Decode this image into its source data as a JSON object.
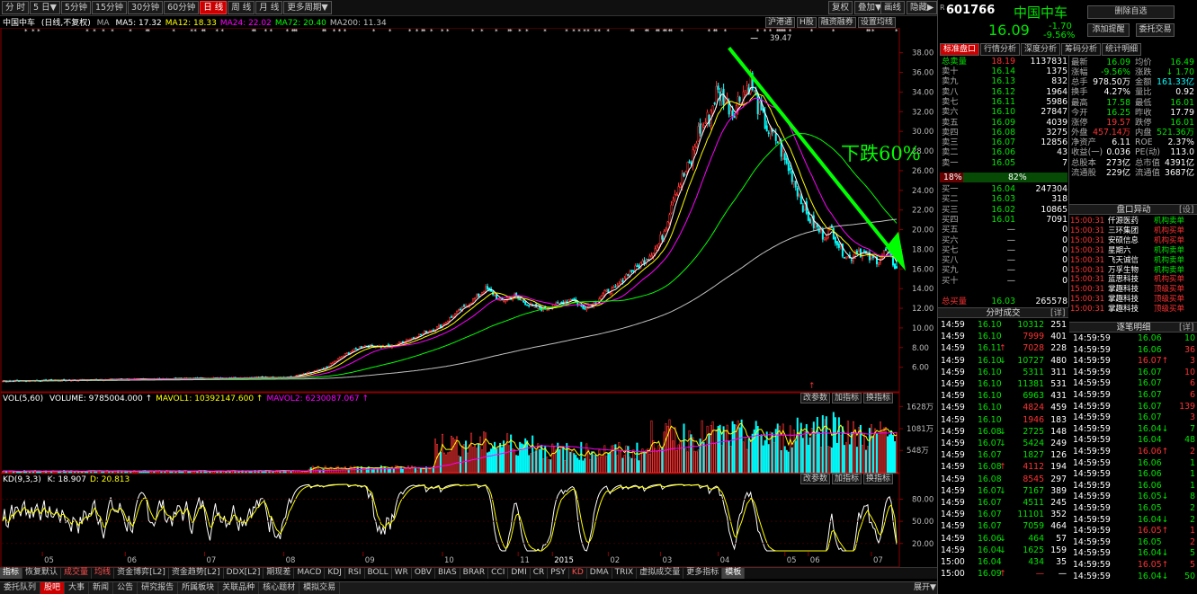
{
  "toolbar": {
    "periods": [
      "分 时",
      "5 日▼",
      "5分钟",
      "15分钟",
      "30分钟",
      "60分钟",
      "日 线",
      "周 线",
      "月 线",
      "更多周期▼"
    ],
    "active_period": "日 线",
    "right_buttons": [
      "复权",
      "叠加▼",
      "画线",
      "隐藏▶"
    ]
  },
  "main_info": {
    "stock": "中国中车",
    "mode": "(日线,不复权)",
    "ma_label": "MA",
    "ma": [
      {
        "label": "MA5: 17.32",
        "color": "#ffffff"
      },
      {
        "label": "MA12: 18.33",
        "color": "#ffff00"
      },
      {
        "label": "MA24: 22.02",
        "color": "#ff00ff"
      },
      {
        "label": "MA72: 20.40",
        "color": "#00ff00"
      },
      {
        "label": "MA200: 11.34",
        "color": "#c0c0c0"
      }
    ],
    "buttons": [
      "沪港通",
      "H股",
      "融资融券",
      "设置均线"
    ]
  },
  "vol_info": {
    "label": "VOL(5,60)",
    "items": [
      {
        "label": "VOLUME: 9785004.000",
        "color": "#ffffff"
      },
      {
        "label": "MAVOL1: 10392147.600",
        "color": "#ffff00"
      },
      {
        "label": "MAVOL2: 6230087.067",
        "color": "#ff00ff"
      }
    ],
    "buttons": [
      "改参数",
      "加指标",
      "换指标"
    ]
  },
  "kd_info": {
    "label": "KD(9,3,3)",
    "items": [
      {
        "label": "K: 18.907",
        "color": "#ffffff"
      },
      {
        "label": "D: 20.813",
        "color": "#ffff00"
      }
    ],
    "buttons": [
      "改参数",
      "加指标",
      "换指标"
    ]
  },
  "annotation": {
    "text": "下跌60%",
    "color": "#00ff00",
    "max_label": "39.47",
    "min_marker": "↑"
  },
  "bottom_tabs": [
    {
      "label": "指标",
      "style": "sel"
    },
    {
      "label": "恢复默认",
      "style": ""
    },
    {
      "label": "成交量",
      "style": "red"
    },
    {
      "label": "均线",
      "style": "red"
    },
    {
      "label": "资金博弈[L2]",
      "style": ""
    },
    {
      "label": "资金趋势[L2]",
      "style": ""
    },
    {
      "label": "DDX[L2]",
      "style": ""
    },
    {
      "label": "期现差",
      "style": ""
    },
    {
      "label": "MACD",
      "style": ""
    },
    {
      "label": "KDJ",
      "style": ""
    },
    {
      "label": "RSI",
      "style": ""
    },
    {
      "label": "BOLL",
      "style": ""
    },
    {
      "label": "WR",
      "style": ""
    },
    {
      "label": "OBV",
      "style": ""
    },
    {
      "label": "BIAS",
      "style": ""
    },
    {
      "label": "BRAR",
      "style": ""
    },
    {
      "label": "CCI",
      "style": ""
    },
    {
      "label": "DMI",
      "style": ""
    },
    {
      "label": "CR",
      "style": ""
    },
    {
      "label": "PSY",
      "style": ""
    },
    {
      "label": "KD",
      "style": "red"
    },
    {
      "label": "DMA",
      "style": ""
    },
    {
      "label": "TRIX",
      "style": ""
    },
    {
      "label": "虚拟成交量",
      "style": ""
    },
    {
      "label": "更多指标",
      "style": ""
    },
    {
      "label": "模板",
      "style": "sel"
    }
  ],
  "taskbar": {
    "items": [
      "委托队列",
      "股吧",
      "大事",
      "新闻",
      "公告",
      "研究报告",
      "所属板块",
      "关联品种",
      "核心题材",
      "模拟交易"
    ],
    "active": "股吧",
    "right": "展开▼"
  },
  "quote": {
    "code": "601766",
    "name": "中国中车",
    "price": "16.09",
    "change": "-1.70",
    "change_pct": "-9.56%",
    "buttons": [
      "删除自选",
      "添加提醒",
      "委托交易"
    ],
    "tabs": [
      "标准盘口",
      "行情分析",
      "深度分析",
      "筹码分析",
      "统计明细"
    ],
    "sell_total": {
      "label": "总卖量",
      "price": "18.19",
      "vol": "1137831"
    },
    "asks": [
      {
        "label": "卖十",
        "price": "16.14",
        "vol": "1375"
      },
      {
        "label": "卖九",
        "price": "16.13",
        "vol": "832"
      },
      {
        "label": "卖八",
        "price": "16.12",
        "vol": "1964"
      },
      {
        "label": "卖七",
        "price": "16.11",
        "vol": "5986"
      },
      {
        "label": "卖六",
        "price": "16.10",
        "vol": "27847"
      },
      {
        "label": "卖五",
        "price": "16.09",
        "vol": "4039"
      },
      {
        "label": "卖四",
        "price": "16.08",
        "vol": "3275"
      },
      {
        "label": "卖三",
        "price": "16.07",
        "vol": "12856"
      },
      {
        "label": "卖二",
        "price": "16.06",
        "vol": "43"
      },
      {
        "label": "卖一",
        "price": "16.05",
        "vol": "7"
      }
    ],
    "ratio": {
      "left": "18%",
      "right": "82%"
    },
    "bids": [
      {
        "label": "买一",
        "price": "16.04",
        "vol": "247304"
      },
      {
        "label": "买二",
        "price": "16.03",
        "vol": "318"
      },
      {
        "label": "买三",
        "price": "16.02",
        "vol": "10865"
      },
      {
        "label": "买四",
        "price": "16.01",
        "vol": "7091"
      },
      {
        "label": "买五",
        "price": "—",
        "vol": "0"
      },
      {
        "label": "买六",
        "price": "—",
        "vol": "0"
      },
      {
        "label": "买七",
        "price": "—",
        "vol": "0"
      },
      {
        "label": "买八",
        "price": "—",
        "vol": "0"
      },
      {
        "label": "买九",
        "price": "—",
        "vol": "0"
      },
      {
        "label": "买十",
        "price": "—",
        "vol": "0"
      }
    ],
    "buy_total": {
      "label": "总买量",
      "price": "16.03",
      "vol": "265578"
    },
    "stats": [
      [
        {
          "k": "最新",
          "v": "16.09",
          "c": "green"
        },
        {
          "k": "均价",
          "v": "16.49",
          "c": "green"
        }
      ],
      [
        {
          "k": "涨幅",
          "v": "-9.56%",
          "c": "green"
        },
        {
          "k": "涨跌",
          "v": "↓ 1.70",
          "c": "green"
        }
      ],
      [
        {
          "k": "总手",
          "v": "978.50万",
          "c": "white"
        },
        {
          "k": "金额",
          "v": "161.33亿",
          "c": "cyan"
        }
      ],
      [
        {
          "k": "换手",
          "v": "4.27%",
          "c": "white"
        },
        {
          "k": "量比",
          "v": "0.92",
          "c": "white"
        }
      ],
      [
        {
          "k": "最高",
          "v": "17.58",
          "c": "green"
        },
        {
          "k": "最低",
          "v": "16.01",
          "c": "green"
        }
      ],
      [
        {
          "k": "今开",
          "v": "16.25",
          "c": "green"
        },
        {
          "k": "昨收",
          "v": "17.79",
          "c": "white"
        }
      ],
      [
        {
          "k": "涨停",
          "v": "19.57",
          "c": "red"
        },
        {
          "k": "跌停",
          "v": "16.01",
          "c": "green"
        }
      ],
      [
        {
          "k": "外盘",
          "v": "457.14万",
          "c": "red"
        },
        {
          "k": "内盘",
          "v": "521.36万",
          "c": "green"
        }
      ],
      [
        {
          "k": "净资产",
          "v": "6.11",
          "c": "white"
        },
        {
          "k": "ROE",
          "v": "2.37%",
          "c": "white"
        }
      ],
      [
        {
          "k": "收益(一)",
          "v": "0.036",
          "c": "white"
        },
        {
          "k": "PE(动)",
          "v": "113.0",
          "c": "white"
        }
      ],
      [
        {
          "k": "总股本",
          "v": "273亿",
          "c": "white"
        },
        {
          "k": "总市值",
          "v": "4391亿",
          "c": "white"
        }
      ],
      [
        {
          "k": "流通股",
          "v": "229亿",
          "c": "white"
        },
        {
          "k": "流通值",
          "v": "3687亿",
          "c": "white"
        }
      ]
    ],
    "movers_title": "盘口异动",
    "movers_setting": "[设]",
    "movers": [
      {
        "t": "15:00:31",
        "n": "仟源医药",
        "a": "机构卖单",
        "c": "green"
      },
      {
        "t": "15:00:31",
        "n": "三环集团",
        "a": "机构买单",
        "c": "red"
      },
      {
        "t": "15:00:31",
        "n": "安硕信息",
        "a": "机构买单",
        "c": "red"
      },
      {
        "t": "15:00:31",
        "n": "星期六",
        "a": "机构卖单",
        "c": "green"
      },
      {
        "t": "15:00:31",
        "n": "飞天诚信",
        "a": "机构卖单",
        "c": "green"
      },
      {
        "t": "15:00:31",
        "n": "万孚生物",
        "a": "机构卖单",
        "c": "green"
      },
      {
        "t": "15:00:31",
        "n": "蓝思科技",
        "a": "机构买单",
        "c": "red"
      },
      {
        "t": "15:00:31",
        "n": "掌趣科技",
        "a": "顶级买单",
        "c": "red"
      },
      {
        "t": "15:00:31",
        "n": "掌趣科技",
        "a": "顶级买单",
        "c": "red"
      },
      {
        "t": "15:00:31",
        "n": "掌趣科技",
        "a": "顶级买单",
        "c": "red"
      }
    ],
    "ticks_title": "分时成交",
    "details_title": "逐笔明细",
    "detail_btn": "[详]",
    "ticks": [
      {
        "t": "14:59",
        "p": "16.10",
        "arrow": "",
        "v": "10312",
        "n": "251",
        "vc": "green"
      },
      {
        "t": "14:59",
        "p": "16.10",
        "arrow": "",
        "v": "7999",
        "n": "401",
        "vc": "red"
      },
      {
        "t": "14:59",
        "p": "16.11",
        "arrow": "↑",
        "v": "7028",
        "n": "228",
        "vc": "red"
      },
      {
        "t": "14:59",
        "p": "16.10",
        "arrow": "↓",
        "v": "10727",
        "n": "480",
        "vc": "green"
      },
      {
        "t": "14:59",
        "p": "16.10",
        "arrow": "",
        "v": "5311",
        "n": "311",
        "vc": "green"
      },
      {
        "t": "14:59",
        "p": "16.10",
        "arrow": "",
        "v": "11381",
        "n": "531",
        "vc": "green"
      },
      {
        "t": "14:59",
        "p": "16.10",
        "arrow": "",
        "v": "6963",
        "n": "431",
        "vc": "green"
      },
      {
        "t": "14:59",
        "p": "16.10",
        "arrow": "",
        "v": "4824",
        "n": "459",
        "vc": "red"
      },
      {
        "t": "14:59",
        "p": "16.10",
        "arrow": "",
        "v": "1946",
        "n": "183",
        "vc": "red"
      },
      {
        "t": "14:59",
        "p": "16.08",
        "arrow": "↓",
        "v": "2725",
        "n": "148",
        "vc": "green"
      },
      {
        "t": "14:59",
        "p": "16.07",
        "arrow": "↓",
        "v": "5424",
        "n": "249",
        "vc": "green"
      },
      {
        "t": "14:59",
        "p": "16.07",
        "arrow": "",
        "v": "1827",
        "n": "126",
        "vc": "green"
      },
      {
        "t": "14:59",
        "p": "16.08",
        "arrow": "↑",
        "v": "4112",
        "n": "194",
        "vc": "red"
      },
      {
        "t": "14:59",
        "p": "16.08",
        "arrow": "",
        "v": "8545",
        "n": "297",
        "vc": "red"
      },
      {
        "t": "14:59",
        "p": "16.07",
        "arrow": "↓",
        "v": "7167",
        "n": "389",
        "vc": "green"
      },
      {
        "t": "14:59",
        "p": "16.07",
        "arrow": "",
        "v": "4511",
        "n": "245",
        "vc": "green"
      },
      {
        "t": "14:59",
        "p": "16.07",
        "arrow": "",
        "v": "11101",
        "n": "352",
        "vc": "green"
      },
      {
        "t": "14:59",
        "p": "16.07",
        "arrow": "",
        "v": "7059",
        "n": "464",
        "vc": "green"
      },
      {
        "t": "14:59",
        "p": "16.06",
        "arrow": "↓",
        "v": "464",
        "n": "57",
        "vc": "green"
      },
      {
        "t": "14:59",
        "p": "16.04",
        "arrow": "↓",
        "v": "1625",
        "n": "159",
        "vc": "green"
      },
      {
        "t": "15:00",
        "p": "16.04",
        "arrow": "",
        "v": "434",
        "n": "35",
        "vc": "green"
      },
      {
        "t": "15:00",
        "p": "16.09",
        "arrow": "↑",
        "v": "—",
        "n": "—",
        "vc": "red"
      }
    ],
    "details": [
      {
        "t": "14:59:59",
        "p": "16.06",
        "v": "10",
        "c": "green"
      },
      {
        "t": "14:59:59",
        "p": "16.06",
        "v": "36",
        "c": "red"
      },
      {
        "t": "14:59:59",
        "p": "16.07↑",
        "v": "3",
        "c": "red"
      },
      {
        "t": "14:59:59",
        "p": "16.07",
        "v": "10",
        "c": "red"
      },
      {
        "t": "14:59:59",
        "p": "16.07",
        "v": "6",
        "c": "red"
      },
      {
        "t": "14:59:59",
        "p": "16.07",
        "v": "6",
        "c": "red"
      },
      {
        "t": "14:59:59",
        "p": "16.07",
        "v": "139",
        "c": "red"
      },
      {
        "t": "14:59:59",
        "p": "16.07",
        "v": "3",
        "c": "red"
      },
      {
        "t": "14:59:59",
        "p": "16.04↓",
        "v": "7",
        "c": "green"
      },
      {
        "t": "14:59:59",
        "p": "16.04",
        "v": "48",
        "c": "green"
      },
      {
        "t": "14:59:59",
        "p": "16.06↑",
        "v": "2",
        "c": "red"
      },
      {
        "t": "14:59:59",
        "p": "16.06",
        "v": "1",
        "c": "green"
      },
      {
        "t": "14:59:59",
        "p": "16.06",
        "v": "1",
        "c": "green"
      },
      {
        "t": "14:59:59",
        "p": "16.06",
        "v": "1",
        "c": "green"
      },
      {
        "t": "14:59:59",
        "p": "16.05↓",
        "v": "8",
        "c": "green"
      },
      {
        "t": "14:59:59",
        "p": "16.05",
        "v": "2",
        "c": "green"
      },
      {
        "t": "14:59:59",
        "p": "16.04↓",
        "v": "2",
        "c": "green"
      },
      {
        "t": "14:59:59",
        "p": "16.05↑",
        "v": "1",
        "c": "red"
      },
      {
        "t": "14:59:59",
        "p": "16.05",
        "v": "2",
        "c": "red"
      },
      {
        "t": "14:59:59",
        "p": "16.04↓",
        "v": "5",
        "c": "green"
      },
      {
        "t": "14:59:59",
        "p": "16.05↑",
        "v": "5",
        "c": "red"
      },
      {
        "t": "14:59:59",
        "p": "16.04↓",
        "v": "50",
        "c": "green"
      }
    ]
  },
  "chart_data": [
    {
      "type": "candlestick",
      "title": "中国中车 (日线,不复权)",
      "x_ticks": [
        "05",
        "06",
        "07",
        "08",
        "09",
        "10",
        "11",
        "2015",
        "02",
        "03",
        "04",
        "05",
        "06",
        "07"
      ],
      "y_ticks": [
        6,
        8,
        10,
        12,
        14,
        16,
        18,
        20,
        22,
        24,
        26,
        28,
        30,
        32,
        34,
        36,
        38
      ],
      "ylim": [
        3.5,
        39.8
      ],
      "grid": true,
      "series_anchor_days": [
        0,
        160,
        178,
        190,
        200,
        215,
        230,
        243,
        255,
        262,
        268,
        272,
        276,
        284,
        292,
        300,
        308,
        316,
        322,
        328,
        334,
        340,
        346,
        352,
        358,
        364,
        368,
        372,
        378,
        382,
        386,
        392,
        396,
        400,
        405,
        410,
        415,
        420,
        425,
        430,
        434,
        438,
        442,
        446,
        450,
        455,
        460,
        465,
        470,
        474,
        478,
        482,
        486,
        490,
        496
      ],
      "close_anchors": [
        4.6,
        5.0,
        5.8,
        7.3,
        8.2,
        8.1,
        9.2,
        10.2,
        12.0,
        13.0,
        14.0,
        13.5,
        12.7,
        13.3,
        12.3,
        11.9,
        12.4,
        13.0,
        12.0,
        12.5,
        13.6,
        14.0,
        15.4,
        16.2,
        17.2,
        18.5,
        20.5,
        23.5,
        25.5,
        27.0,
        30.0,
        31.5,
        34.0,
        33.5,
        32.0,
        33.8,
        35.0,
        32.0,
        30.0,
        29.0,
        27.0,
        25.5,
        23.5,
        21.5,
        20.5,
        19.5,
        20.0,
        18.0,
        17.0,
        18.0,
        17.5,
        17.0,
        17.0,
        17.79,
        16.09
      ],
      "ma": [
        {
          "name": "MA5",
          "window": 5,
          "color": "#ffffff"
        },
        {
          "name": "MA12",
          "window": 12,
          "color": "#ffff00"
        },
        {
          "name": "MA24",
          "window": 24,
          "color": "#ff00ff"
        },
        {
          "name": "MA72",
          "window": 72,
          "color": "#00ff00"
        },
        {
          "name": "MA200",
          "window": 200,
          "color": "#c0c0c0"
        }
      ],
      "max": 39.47,
      "last": {
        "close": 16.09,
        "open": 16.25,
        "high": 17.58,
        "low": 16.01
      }
    },
    {
      "type": "bar",
      "title": "VOL(5,60)",
      "y_ticks_labels": [
        "548万",
        "1081万",
        "1628万"
      ],
      "y_ticks": [
        548,
        1081,
        1628
      ],
      "ylim": [
        0,
        1700
      ],
      "value_unit": "万手"
    },
    {
      "type": "line",
      "title": "KD(9,3,3)",
      "y_ticks": [
        20,
        50,
        80
      ],
      "ylim": [
        10,
        100
      ],
      "series": [
        {
          "name": "K",
          "color": "#ffffff"
        },
        {
          "name": "D",
          "color": "#ffff00"
        }
      ],
      "last": {
        "K": 18.907,
        "D": 20.813
      }
    }
  ]
}
